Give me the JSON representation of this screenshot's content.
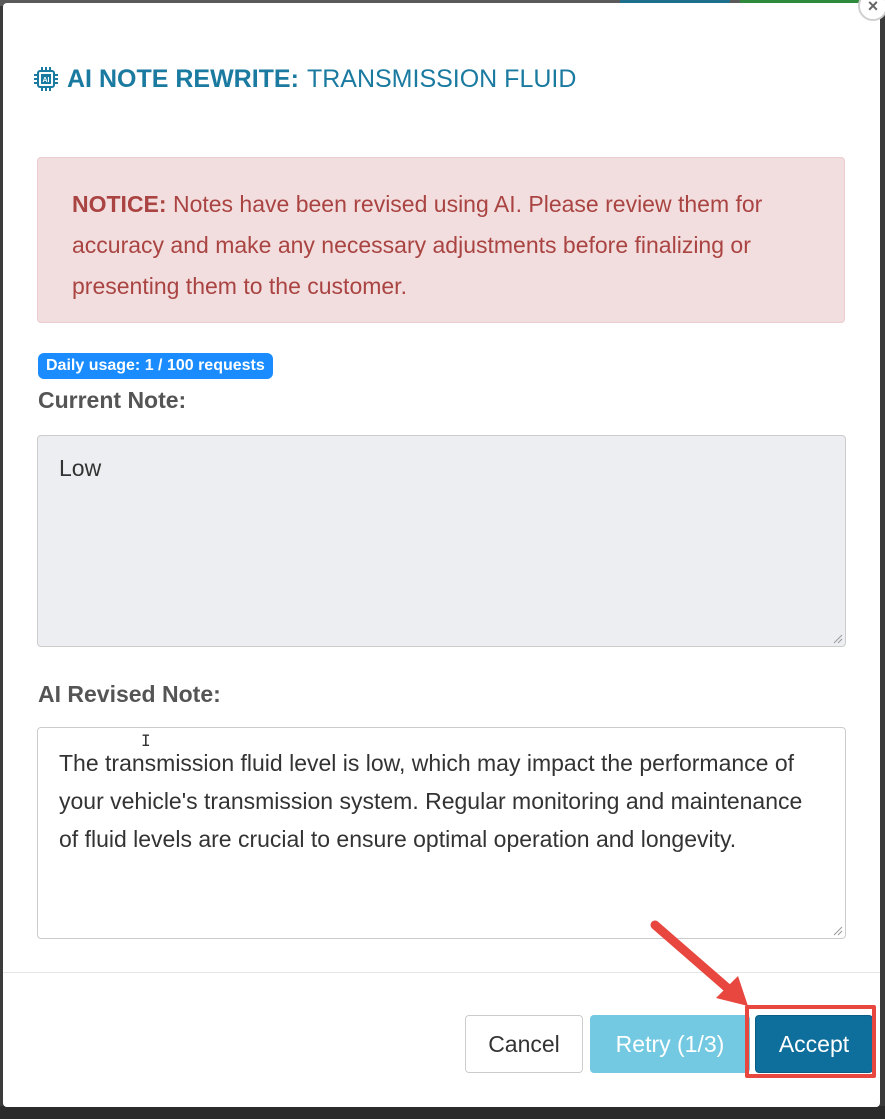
{
  "dialog": {
    "title_prefix": "AI NOTE REWRITE:",
    "title_item": "TRANSMISSION FLUID",
    "close_symbol": "×"
  },
  "notice": {
    "label": "NOTICE:",
    "text": " Notes have been revised using AI. Please review them for accuracy and make any necessary adjustments before finalizing or presenting them to the customer."
  },
  "usage": {
    "badge": "Daily usage: 1 / 100 requests"
  },
  "current_note": {
    "label": "Current Note:",
    "value": "Low"
  },
  "revised_note": {
    "label": "AI Revised Note:",
    "value": "The transmission fluid level is low, which may impact the performance of your vehicle's transmission system. Regular monitoring and maintenance of fluid levels are crucial to ensure optimal operation and longevity."
  },
  "footer": {
    "cancel_label": "Cancel",
    "retry_label": "Retry (1/3)",
    "accept_label": "Accept"
  },
  "colors": {
    "accent": "#1a7aa0",
    "notice_bg": "#f2dede",
    "notice_text": "#a94442",
    "badge": "#1a8cff",
    "accept": "#0e6f9d",
    "retry": "#5bc0de",
    "highlight": "#e8473f"
  }
}
